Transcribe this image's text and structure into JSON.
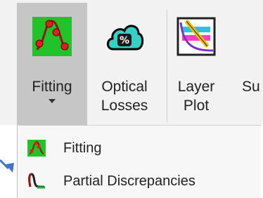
{
  "ribbon": {
    "buttons": [
      {
        "label_line1": "Fitting",
        "label_line2": "",
        "icon": "fitting-curve-icon"
      },
      {
        "label_line1": "Optical",
        "label_line2": "Losses",
        "icon": "cloud-percent-icon"
      },
      {
        "label_line1": "Layer",
        "label_line2": "Plot",
        "icon": "layer-plot-icon"
      },
      {
        "label_line1": "Su",
        "label_line2": "",
        "icon": ""
      }
    ]
  },
  "menu": {
    "items": [
      {
        "label": "Fitting",
        "icon": "fitting-curve-icon"
      },
      {
        "label": "Partial Discrepancies",
        "icon": "discrepancy-curve-icon"
      }
    ]
  },
  "colors": {
    "ribbon_bg": "#f2f2f2",
    "selected_bg": "#c6c6c6",
    "menu_bg": "#f7f7f7",
    "fitting_green": "#22c22a",
    "cloud_teal": "#38cfc6",
    "arrow_blue": "#4472c4"
  }
}
